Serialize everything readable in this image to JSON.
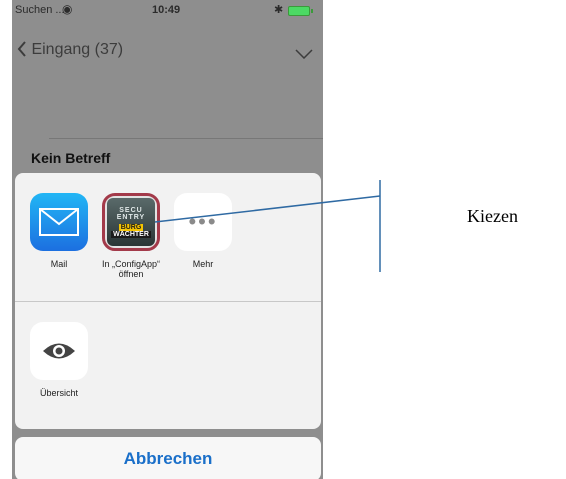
{
  "status_bar": {
    "carrier": "Suchen ...",
    "time": "10:49"
  },
  "nav": {
    "back_label": "Eingang (37)"
  },
  "message": {
    "subject": "Kein Betreff"
  },
  "share_sheet": {
    "apps": [
      {
        "label": "Mail",
        "icon": "mail-icon"
      },
      {
        "label": "In „ConfigApp“\nöffnen",
        "icon": "secu-entry-burg-waechter-icon"
      },
      {
        "label": "Mehr",
        "icon": "more-dots-icon"
      }
    ],
    "actions": [
      {
        "label": "Übersicht",
        "icon": "eye-icon"
      }
    ],
    "cancel_label": "Abbrechen"
  },
  "app_icon_text": {
    "line1": "SECU ENTRY",
    "line2": "BURG",
    "line3": "WÄCHTER"
  },
  "annotation": {
    "text": "Kiezen"
  },
  "colors": {
    "accent": "#1a6fc9",
    "overlay": "#8e8e8e",
    "callout_line": "#2f6aa3"
  }
}
